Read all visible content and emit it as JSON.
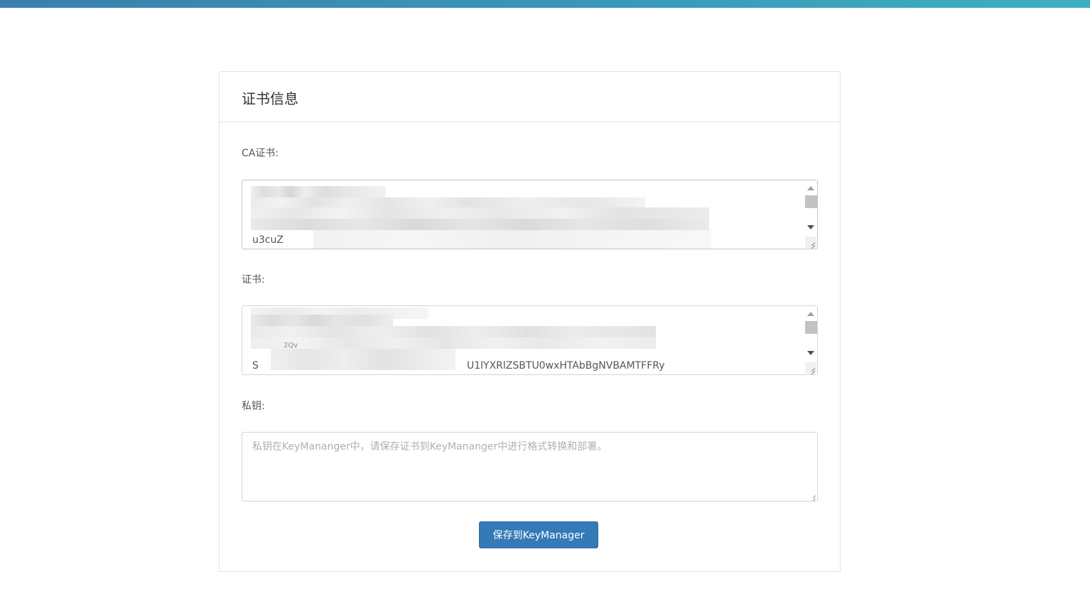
{
  "panel": {
    "title": "证书信息"
  },
  "fields": {
    "ca_cert": {
      "label": "CA证书:",
      "visible_text_fragment": "u3cuZ"
    },
    "cert": {
      "label": "证书:",
      "visible_text_fragment_1": "S",
      "visible_text_fragment_2": "U1lYXRlZSBTU0wxHTAbBgNVBAMTFFRy",
      "visible_text_fragment_3": "2Qv"
    },
    "private_key": {
      "label": "私钥:",
      "placeholder": "私钥在KeyMananger中，请保存证书到KeyMananger中进行格式转换和部署。"
    }
  },
  "actions": {
    "save_label": "保存到KeyManager"
  },
  "colors": {
    "top_bar_start": "#3a7fae",
    "top_bar_end": "#3cb0c0",
    "primary_button": "#337ab7"
  }
}
